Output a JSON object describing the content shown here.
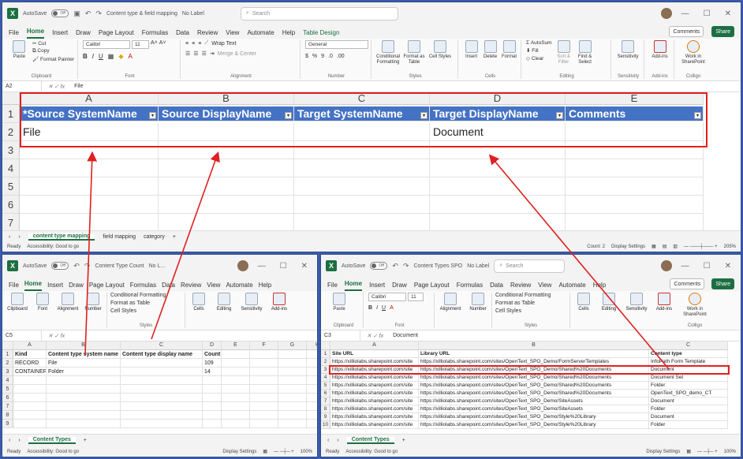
{
  "colors": {
    "excel_green": "#1d6f42",
    "header_blue": "#4472c4",
    "annotation_red": "#e02020"
  },
  "top": {
    "autosave": "AutoSave",
    "toggle": "Off",
    "title": "Content type & field mapping",
    "label": "No Label",
    "search": "Search",
    "menu": [
      "File",
      "Home",
      "Insert",
      "Draw",
      "Page Layout",
      "Formulas",
      "Data",
      "Review",
      "View",
      "Automate",
      "Help",
      "Table Design"
    ],
    "comments": "Comments",
    "share": "Share",
    "ribbon": {
      "paste": "Paste",
      "cut": "Cut",
      "copy": "Copy",
      "format_painter": "Format Painter",
      "clipboard": "Clipboard",
      "font_name": "Calibri",
      "font_size": "11",
      "font": "Font",
      "wrap_text": "Wrap Text",
      "merge_center": "Merge & Center",
      "alignment": "Alignment",
      "number_format": "General",
      "number": "Number",
      "conditional": "Conditional Formatting",
      "format_table": "Format as Table",
      "cell_styles": "Cell Styles",
      "styles": "Styles",
      "insert": "Insert",
      "delete": "Delete",
      "format": "Format",
      "cells": "Cells",
      "autosum": "AutoSum",
      "fill": "Fill",
      "clear": "Clear",
      "sort_filter": "Sort & Filter",
      "find_select": "Find & Select",
      "editing": "Editing",
      "sensitivity": "Sensitivity",
      "addins": "Add-ins",
      "work_sp": "Work in SharePoint",
      "colligo": "Colligo"
    },
    "namebox": "A2",
    "formula": "File",
    "columns": [
      "A",
      "B",
      "C",
      "D",
      "E"
    ],
    "rows": [
      "1",
      "2",
      "3",
      "4",
      "5",
      "6",
      "7"
    ],
    "headers": [
      "*Source SystemName",
      "Source DisplayName",
      "Target SystemName",
      "Target DisplayName",
      "Comments"
    ],
    "row2": [
      "File",
      "",
      "",
      "Document",
      ""
    ],
    "tabs": [
      "content type mapping",
      "field mapping",
      "category"
    ],
    "status_ready": "Ready",
    "accessibility": "Accessibility: Good to go",
    "count": "Count: 2",
    "display_settings": "Display Settings",
    "zoom": "205%"
  },
  "bl": {
    "autosave": "AutoSave",
    "toggle": "Off",
    "title": "Content Type Count",
    "label": "No L...",
    "menu": [
      "File",
      "Home",
      "Insert",
      "Draw",
      "Page Layout",
      "Formulas",
      "Data",
      "Review",
      "View",
      "Automate",
      "Help"
    ],
    "ribbon": [
      "Clipboard",
      "Font",
      "Alignment",
      "Number",
      "Conditional Formatting",
      "Format as Table",
      "Cell Styles",
      "Cells",
      "Editing",
      "Sensitivity",
      "Add-ins"
    ],
    "styles": "Styles",
    "sens_label": "Sensitivity",
    "addin_label": "Add-in",
    "namebox": "C5",
    "formula": "",
    "columns": [
      "A",
      "B",
      "C",
      "D",
      "E",
      "F",
      "G",
      "H"
    ],
    "rows": [
      "1",
      "2",
      "3",
      "4",
      "5",
      "6",
      "7",
      "8",
      "9"
    ],
    "data": [
      [
        "Kind",
        "Content type system name",
        "Content type display name",
        "Count"
      ],
      [
        "RECORD",
        "File",
        "",
        "109"
      ],
      [
        "CONTAINER",
        "Folder",
        "",
        "14"
      ]
    ],
    "tab": "Content Types",
    "status_ready": "Ready",
    "accessibility": "Accessibility: Good to go",
    "display_settings": "Display Settings",
    "zoom": "100%"
  },
  "br": {
    "autosave": "AutoSave",
    "toggle": "Off",
    "title": "Content Types SPO",
    "label": "No Label",
    "search": "Search",
    "menu": [
      "File",
      "Home",
      "Insert",
      "Draw",
      "Page Layout",
      "Formulas",
      "Data",
      "Review",
      "View",
      "Automate",
      "Help"
    ],
    "comments": "Comments",
    "share": "Share",
    "ribbon": {
      "paste": "Paste",
      "clipboard": "Clipboard",
      "font_name": "Calibri",
      "font_size": "11",
      "font": "Font",
      "alignment": "Alignment",
      "number": "Number",
      "conditional": "Conditional Formatting",
      "format_table": "Format as Table",
      "cell_styles": "Cell Styles",
      "styles": "Styles",
      "cells": "Cells",
      "editing": "Editing",
      "sensitivity": "Sensitivity",
      "addins": "Add-ins",
      "work_sp": "Work in SharePoint",
      "colligo": "Colligo"
    },
    "namebox": "C3",
    "formula": "Document",
    "columns": [
      "A",
      "B",
      "C"
    ],
    "rows": [
      "1",
      "2",
      "3",
      "4",
      "5",
      "6",
      "7",
      "8",
      "9",
      "10"
    ],
    "data": [
      [
        "Site URL",
        "Library URL",
        "Content type"
      ],
      [
        "https://xilliolabs.sharepoint.com/site",
        "https://xilliolabs.sharepoint.com/sites/OpenText_SPO_Demo/FormServerTemplates",
        "InfoPath Form Template"
      ],
      [
        "https://xilliolabs.sharepoint.com/site",
        "https://xilliolabs.sharepoint.com/sites/OpenText_SPO_Demo/Shared%20Documents",
        "Document"
      ],
      [
        "https://xilliolabs.sharepoint.com/site",
        "https://xilliolabs.sharepoint.com/sites/OpenText_SPO_Demo/Shared%20Documents",
        "Document Set"
      ],
      [
        "https://xilliolabs.sharepoint.com/site",
        "https://xilliolabs.sharepoint.com/sites/OpenText_SPO_Demo/Shared%20Documents",
        "Folder"
      ],
      [
        "https://xilliolabs.sharepoint.com/site",
        "https://xilliolabs.sharepoint.com/sites/OpenText_SPO_Demo/Shared%20Documents",
        "OpenText_SPO_demo_CT"
      ],
      [
        "https://xilliolabs.sharepoint.com/site",
        "https://xilliolabs.sharepoint.com/sites/OpenText_SPO_Demo/SiteAssets",
        "Document"
      ],
      [
        "https://xilliolabs.sharepoint.com/site",
        "https://xilliolabs.sharepoint.com/sites/OpenText_SPO_Demo/SiteAssets",
        "Folder"
      ],
      [
        "https://xilliolabs.sharepoint.com/site",
        "https://xilliolabs.sharepoint.com/sites/OpenText_SPO_Demo/Style%20Library",
        "Document"
      ],
      [
        "https://xilliolabs.sharepoint.com/site",
        "https://xilliolabs.sharepoint.com/sites/OpenText_SPO_Demo/Style%20Library",
        "Folder"
      ]
    ],
    "tab": "Content Types",
    "status_ready": "Ready",
    "accessibility": "Accessibility: Good to go",
    "display_settings": "Display Settings",
    "zoom": "100%"
  }
}
